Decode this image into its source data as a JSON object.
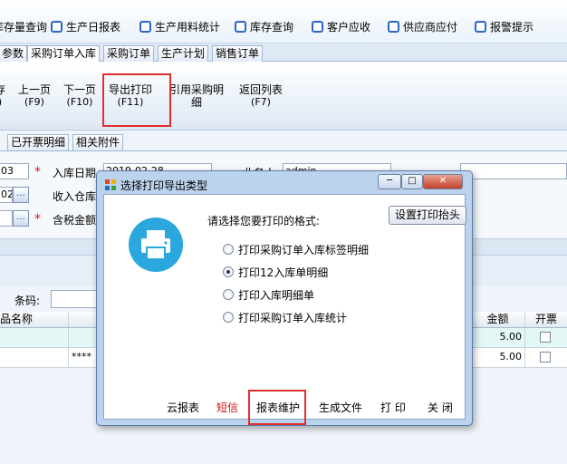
{
  "quick_links": [
    {
      "label": "库存量查询"
    },
    {
      "label": "生产日报表"
    },
    {
      "label": "生产用料统计"
    },
    {
      "label": "库存查询"
    },
    {
      "label": "客户应收"
    },
    {
      "label": "供应商应付"
    },
    {
      "label": "报警提示"
    }
  ],
  "tabs": [
    "参数",
    "采购订单入库",
    "采购订单",
    "生产计划",
    "销售订单"
  ],
  "toolbar": {
    "save_partial": "存",
    "prev": {
      "label": "上一页",
      "key": "(F9)"
    },
    "next": {
      "label": "下一页",
      "key": "(F10)"
    },
    "export": {
      "label": "导出打印",
      "key": "(F11)"
    },
    "ref": {
      "label": "引用采购明",
      "label2": "细"
    },
    "back": {
      "label": "返回列表",
      "key": "(F7)"
    }
  },
  "subtabs": [
    "已开票明细",
    "相关附件"
  ],
  "form": {
    "field1_value": "03",
    "field2_value": "02",
    "entry_date_label": "入库日期",
    "entry_date_value": "2019-02-28",
    "warehouse_label": "收入仓库",
    "tax_amount_label": "含税金额",
    "operator_label": "业务人",
    "operator_value": "admin"
  },
  "barcode_label": "条码:",
  "grid": {
    "headers": {
      "name": "品名称",
      "amount": "金额",
      "invoice": "开票"
    },
    "rows": [
      {
        "amount": "5.00",
        "mask": ""
      },
      {
        "amount": "5.00",
        "mask": "****"
      }
    ]
  },
  "dialog": {
    "title": "选择打印导出类型",
    "prompt": "请选择您要打印的格式:",
    "setup_button": "设置打印抬头",
    "options": [
      "打印采购订单入库标签明细",
      "打印12入库单明细",
      "打印入库明细单",
      "打印采购订单入库统计"
    ],
    "selected_index": 1,
    "footer": {
      "cloud_report": "云报表",
      "sms": "短信",
      "report_maint": "报表维护",
      "gen_file": "生成文件",
      "print": "打 印",
      "close": "关 闭"
    }
  },
  "colors": {
    "accent_red": "#e0302c",
    "printer_circle": "#2aa7dd",
    "sms_red": "#d11111"
  }
}
